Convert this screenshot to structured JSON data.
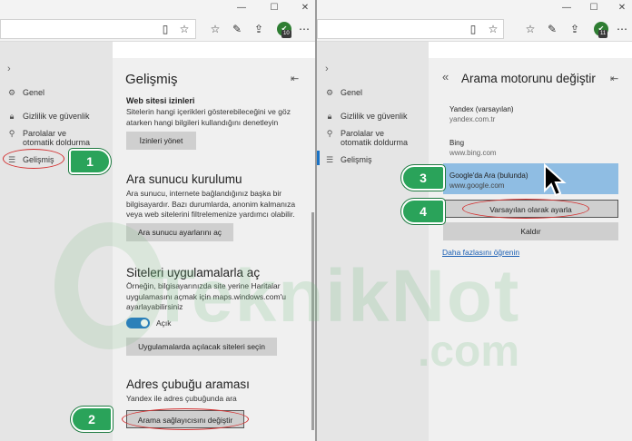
{
  "window": {
    "minimize": "—",
    "maximize": "☐",
    "close": "✕"
  },
  "toolbar": {
    "extension_count": "10",
    "extension_count_right": "11"
  },
  "left_pane": {
    "sidebar": {
      "items": [
        {
          "label": "Genel",
          "icon": "gear-icon"
        },
        {
          "label": "Gizlilik ve güvenlik",
          "icon": "lock-icon"
        },
        {
          "label": "Parolalar ve otomatik doldurma",
          "icon": "key-icon"
        },
        {
          "label": "Gelişmiş",
          "icon": "sliders-icon"
        }
      ]
    },
    "settings": {
      "title": "Gelişmiş",
      "site_permissions": {
        "heading": "Web sitesi izinleri",
        "description": "Sitelerin hangi içerikleri gösterebileceğini ve göz atarken hangi bilgileri kullandığını denetleyin",
        "button": "İzinleri yönet"
      },
      "proxy": {
        "heading": "Ara sunucu kurulumu",
        "description": "Ara sunucu, internete bağlandığınız başka bir bilgisayardır. Bazı durumlarda, anonim kalmanıza veya web sitelerini filtrelemenize yardımcı olabilir.",
        "button": "Ara sunucu ayarlarını aç"
      },
      "apps": {
        "heading": "Siteleri uygulamalarla aç",
        "description": "Örneğin, bilgisayarınızda site yerine Haritalar uygulamasını açmak için maps.windows.com'u ayarlayabilirsiniz",
        "toggle_label": "Açık",
        "toggle_on": true,
        "button": "Uygulamalarda açılacak siteleri seçin"
      },
      "address_bar": {
        "heading": "Adres çubuğu araması",
        "description": "Yandex ile adres çubuğunda ara",
        "button": "Arama sağlayıcısını değiştir"
      }
    }
  },
  "right_pane": {
    "sidebar": {
      "items": [
        {
          "label": "Genel",
          "icon": "gear-icon"
        },
        {
          "label": "Gizlilik ve güvenlik",
          "icon": "lock-icon"
        },
        {
          "label": "Parolalar ve otomatik doldurma",
          "icon": "key-icon"
        },
        {
          "label": "Gelişmiş",
          "icon": "sliders-icon"
        }
      ]
    },
    "search_engine": {
      "back": "«",
      "title": "Arama motorunu değiştir",
      "engines": [
        {
          "name": "Yandex (varsayılan)",
          "url": "yandex.com.tr"
        },
        {
          "name": "Bing",
          "url": "www.bing.com"
        },
        {
          "name": "Google'da Ara (bulunda)",
          "url": "www.google.com",
          "selected": true
        }
      ],
      "set_default_button": "Varsayılan olarak ayarla",
      "remove_button": "Kaldır",
      "learn_more_link": "Daha fazlasını öğrenin"
    }
  },
  "callouts": [
    "1",
    "2",
    "3",
    "4"
  ],
  "watermark": {
    "text": "TeknikNot",
    "sub": ".com"
  },
  "colors": {
    "accent": "#1a73c6",
    "callout": "#2aa35a",
    "highlight_ring": "#d32f2f",
    "selected_engine": "#8fbde3"
  }
}
